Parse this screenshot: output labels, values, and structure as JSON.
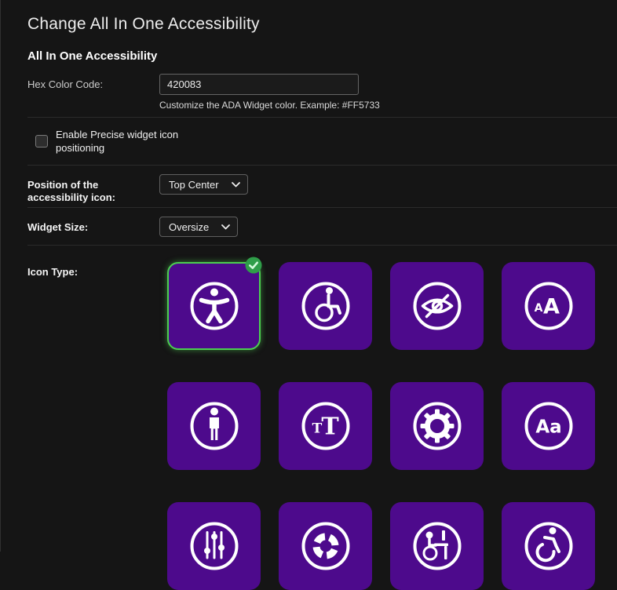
{
  "page": {
    "title": "Change All In One Accessibility",
    "section_heading": "All In One Accessibility"
  },
  "form": {
    "hex_color": {
      "label": "Hex Color Code:",
      "value": "420083",
      "help": "Customize the ADA Widget color. Example: #FF5733"
    },
    "precise_positioning": {
      "label": "Enable Precise widget icon positioning",
      "checked": false
    },
    "position": {
      "label": "Position of the accessibility icon:",
      "value": "Top Center"
    },
    "widget_size": {
      "label": "Widget Size:",
      "value": "Oversize"
    },
    "icon_type": {
      "label": "Icon Type:",
      "selected": "universal-access",
      "options": [
        "universal-access",
        "wheelchair",
        "eye-slash",
        "font-size-aA",
        "standing-person",
        "text-size-TT",
        "settings-gear",
        "letters-Aa",
        "adjust-sliders",
        "support-wheel",
        "workstation-person",
        "active-wheelchair"
      ]
    }
  },
  "colors": {
    "background": "#151515",
    "tile_purple": "#4D0A8C",
    "selected_border_green": "#4CCF50",
    "badge_green": "#2F9E49",
    "divider": "#2B2B2B"
  }
}
